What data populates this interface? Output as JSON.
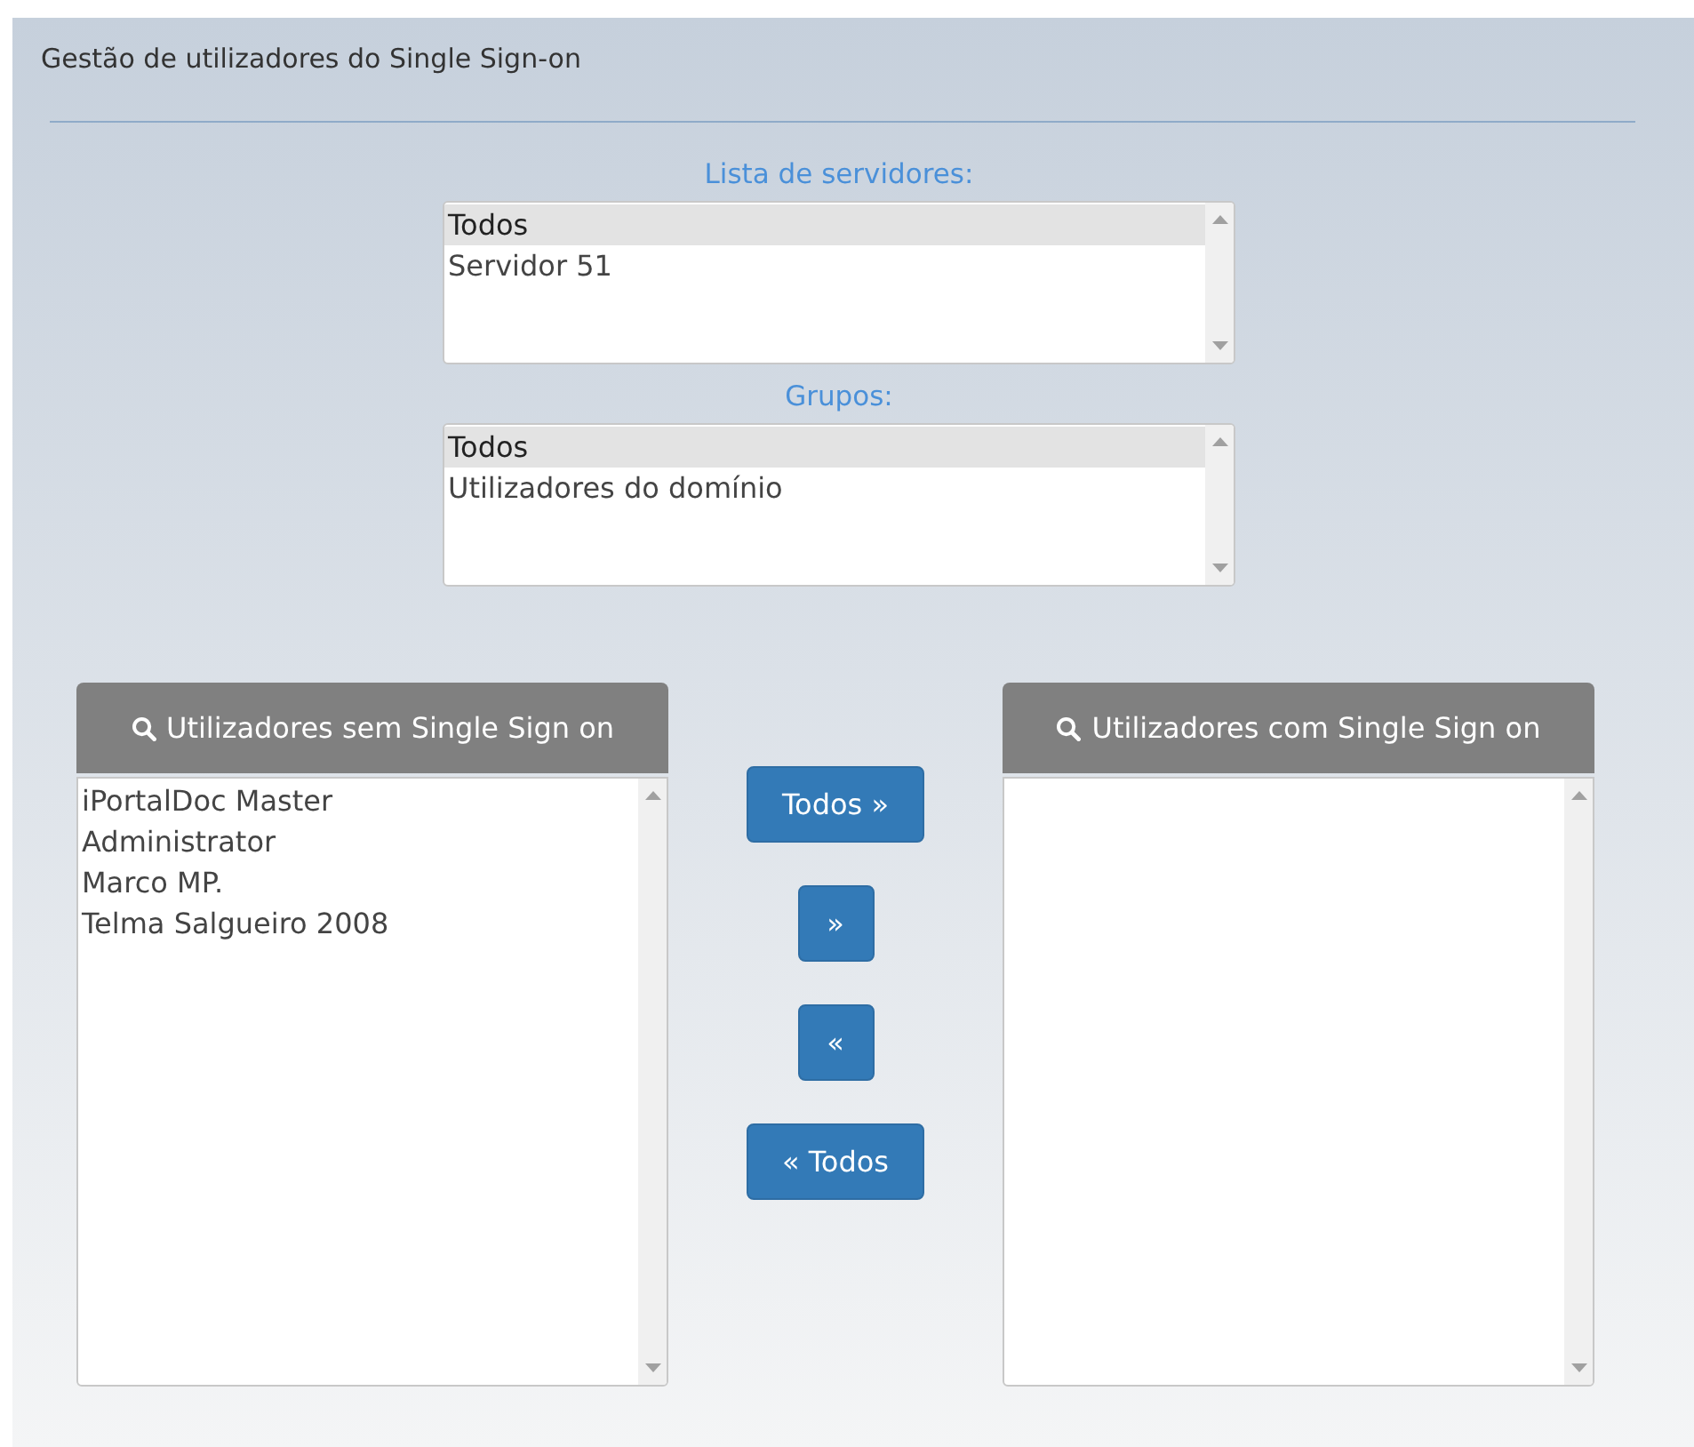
{
  "page": {
    "title": "Gestão de utilizadores do Single Sign-on"
  },
  "filters": [
    {
      "label": "Lista de servidores:",
      "items": [
        {
          "text": "Todos",
          "selected": true
        },
        {
          "text": "Servidor 51",
          "selected": false
        }
      ]
    },
    {
      "label": "Grupos:",
      "items": [
        {
          "text": "Todos",
          "selected": true
        },
        {
          "text": "Utilizadores do domínio",
          "selected": false
        }
      ]
    }
  ],
  "panels": [
    {
      "title": "Utilizadores sem Single Sign on",
      "items": [
        {
          "text": "iPortalDoc Master",
          "selected": false
        },
        {
          "text": "Administrator",
          "selected": false
        },
        {
          "text": "Marco MP.",
          "selected": false
        },
        {
          "text": "Telma Salgueiro 2008",
          "selected": false
        }
      ]
    },
    {
      "title": "Utilizadores com Single Sign on"
    }
  ],
  "buttons": [
    {
      "label": "Todos »",
      "kind": "wide"
    },
    {
      "label": "»",
      "kind": "small"
    },
    {
      "label": "«",
      "kind": "small"
    },
    {
      "label": "« Todos",
      "kind": "wide"
    }
  ]
}
